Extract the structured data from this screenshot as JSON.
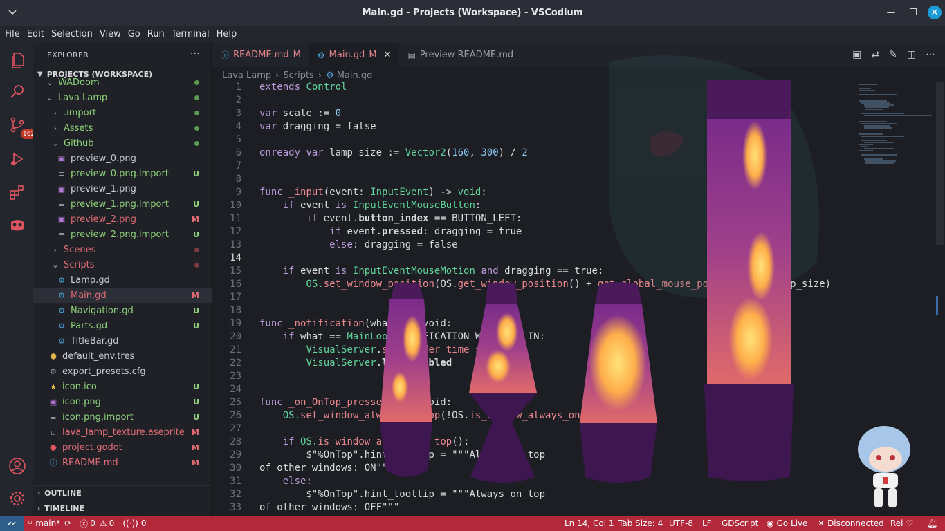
{
  "window": {
    "title": "Main.gd - Projects (Workspace) - VSCodium",
    "minimize": "—",
    "maximize": "❐",
    "close": "✕"
  },
  "menu": [
    "File",
    "Edit",
    "Selection",
    "View",
    "Go",
    "Run",
    "Terminal",
    "Help"
  ],
  "activity": {
    "scm_badge": "162"
  },
  "sidebar": {
    "header": "EXPLORER",
    "more": "···",
    "workspace": "PROJECTS (WORKSPACE)",
    "items": [
      {
        "label": "WADoom",
        "status": ""
      },
      {
        "label": "Lava Lamp",
        "status": ""
      },
      {
        "label": ".import",
        "status": ""
      },
      {
        "label": "Assets",
        "status": ""
      },
      {
        "label": "Github",
        "status": ""
      },
      {
        "label": "preview_0.png",
        "status": ""
      },
      {
        "label": "preview_0.png.import",
        "status": "U"
      },
      {
        "label": "preview_1.png",
        "status": ""
      },
      {
        "label": "preview_1.png.import",
        "status": "U"
      },
      {
        "label": "preview_2.png",
        "status": "M"
      },
      {
        "label": "preview_2.png.import",
        "status": "U"
      },
      {
        "label": "Scenes",
        "status": ""
      },
      {
        "label": "Scripts",
        "status": ""
      },
      {
        "label": "Lamp.gd",
        "status": ""
      },
      {
        "label": "Main.gd",
        "status": "M"
      },
      {
        "label": "Navigation.gd",
        "status": "U"
      },
      {
        "label": "Parts.gd",
        "status": "U"
      },
      {
        "label": "TitleBar.gd",
        "status": ""
      },
      {
        "label": "default_env.tres",
        "status": ""
      },
      {
        "label": "export_presets.cfg",
        "status": ""
      },
      {
        "label": "icon.ico",
        "status": "U"
      },
      {
        "label": "icon.png",
        "status": "U"
      },
      {
        "label": "icon.png.import",
        "status": "U"
      },
      {
        "label": "lava_lamp_texture.aseprite",
        "status": "M"
      },
      {
        "label": "project.godot",
        "status": "M"
      },
      {
        "label": "README.md",
        "status": "M"
      }
    ],
    "outline": "OUTLINE",
    "timeline": "TIMELINE"
  },
  "tabs": [
    {
      "label": "README.md",
      "mod": "M"
    },
    {
      "label": "Main.gd",
      "mod": "M",
      "close": "✕"
    },
    {
      "label": "Preview README.md",
      "mod": ""
    }
  ],
  "breadcrumb": [
    "Lava Lamp",
    "Scripts",
    "Main.gd"
  ],
  "code": {
    "line_numbers": [
      "1",
      "2",
      "3",
      "4",
      "5",
      "6",
      "7",
      "8",
      "9",
      "10",
      "11",
      "12",
      "13",
      "14",
      "15",
      "16",
      "17",
      "18",
      "19",
      "20",
      "21",
      "22",
      "23",
      "24",
      "25",
      "26",
      "27",
      "28",
      "29",
      "30",
      "31",
      "32",
      "33"
    ],
    "l1a": "extends",
    "l1b": "Control",
    "l3a": "var",
    "l3b": "scale := ",
    "l3c": "0",
    "l4a": "var",
    "l4b": "dragging = false",
    "l6a": "onready var",
    "l6b": "lamp_size := ",
    "l6c": "Vector2",
    "l6d": "(",
    "l6e": "160",
    "l6f": ", ",
    "l6g": "300",
    "l6h": ") / ",
    "l6i": "2",
    "l9a": "func",
    "l9b": "_input",
    "l9c": "(event: ",
    "l9d": "InputEvent",
    "l9e": ") -> ",
    "l9f": "void",
    "l10a": "if",
    "l10b": "event",
    "l10c": "is",
    "l10d": "InputEventMouseButton",
    "l11a": "if",
    "l11b": "event.",
    "l11c": "button_index",
    "l11d": " == BUTTON_LEFT:",
    "l12a": "if",
    "l12b": "event.",
    "l12c": "pressed",
    "l12d": ": dragging = true",
    "l13a": "else",
    "l13b": ": dragging = false",
    "l15a": "if",
    "l15b": "event",
    "l15c": "is",
    "l15d": "InputEventMouseMotion",
    "l15e": "and",
    "l15f": "dragging == true:",
    "l16a": "OS.",
    "l16b": "set_window_position",
    "l16c": "(OS.",
    "l16d": "get_window_position",
    "l16e": "() + ",
    "l16f": "get_global_mouse_position",
    "l16g": "() - lamp_size)",
    "l19a": "func",
    "l19b": "_notification",
    "l19c": "(what",
    "l19d": ") -> void:",
    "l20a": "if",
    "l20b": "what == ",
    "l20c": "MainLoop",
    "l20d": ".NOTIFICATION_WM_FOCUS_IN:",
    "l21a": "VisualServer",
    "l21b": ".",
    "l21c": "set_render_time_scale",
    "l21d": ")",
    "l22a": "VisualServer",
    "l22b": ".",
    "l22c": "loop_enabled",
    "l25a": "func",
    "l25b": "_on_OnTop_pressed",
    "l25c": "() -> void:",
    "l26a": "OS.",
    "l26b": "set_window_always_on_top",
    "l26c": "(!OS.",
    "l26d": "is_window_always_on_top",
    "l26e": "())",
    "l28a": "if",
    "l28b": "OS.",
    "l28c": "is_window_always_on_top",
    "l28d": "():",
    "l29": "$\"%OnTop\".hint_tooltip = \"\"\"Always on top",
    "l30": "of other windows: ON\"\"\"",
    "l31a": "else",
    "l31b": ":",
    "l32": "$\"%OnTop\".hint_tooltip = \"\"\"Always on top",
    "l33": "of other windows: OFF\"\"\""
  },
  "status": {
    "branch": "main*",
    "errors": "0",
    "warnings": "0",
    "ports": "0",
    "position": "Ln 14, Col 1",
    "tab_size": "Tab Size: 4",
    "encoding": "UTF-8",
    "eol": "LF",
    "language": "GDScript",
    "live": "Go Live",
    "connection": "Disconnected",
    "user": "Rei"
  },
  "colors": {
    "statusbar": "#b4283c",
    "accent_blue": "#1b9ad6",
    "git_green": "#8fd07a",
    "git_red": "#e06c75"
  }
}
